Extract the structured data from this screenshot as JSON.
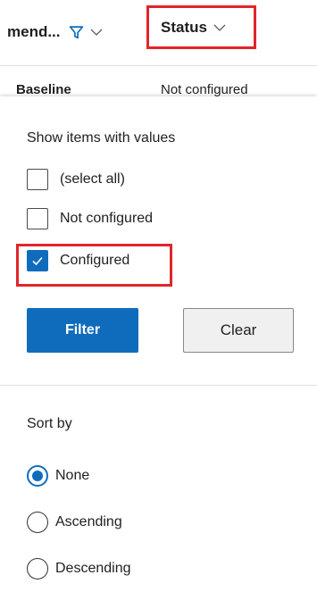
{
  "header": {
    "left_column_label": "mend...",
    "status_column_label": "Status"
  },
  "row": {
    "baseline_label": "Baseline",
    "baseline_status": "Not configured"
  },
  "filter_panel": {
    "title": "Show items with values",
    "options": [
      {
        "label": "(select all)",
        "checked": false
      },
      {
        "label": "Not configured",
        "checked": false
      },
      {
        "label": "Configured",
        "checked": true
      }
    ],
    "filter_button": "Filter",
    "clear_button": "Clear"
  },
  "sort": {
    "title": "Sort by",
    "options": [
      {
        "label": "None",
        "selected": true
      },
      {
        "label": "Ascending",
        "selected": false
      },
      {
        "label": "Descending",
        "selected": false
      }
    ]
  },
  "icons": {
    "filter": "filter-icon",
    "chevron": "chevron-down-icon",
    "check": "checkmark-icon"
  },
  "colors": {
    "accent": "#0f6cbd",
    "highlight": "#e0262a"
  }
}
